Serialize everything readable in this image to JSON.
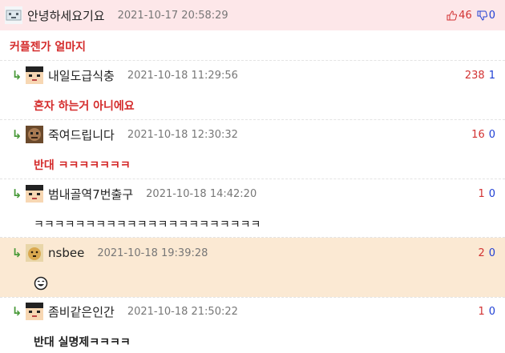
{
  "post": {
    "nick": "안녕하세요기요",
    "date": "2021-10-17 20:58:29",
    "up": "46",
    "down": "0",
    "text": "커플젠가 얼마지"
  },
  "replies": [
    {
      "nick": "내일도급식충",
      "date": "2021-10-18 11:29:56",
      "up": "238",
      "down": "1",
      "text": "혼자 하는거 아니에요"
    },
    {
      "nick": "죽여드립니다",
      "date": "2021-10-18 12:30:32",
      "up": "16",
      "down": "0",
      "text": "반대 ㅋㅋㅋㅋㅋㅋㅋ"
    },
    {
      "nick": "범내골역7번출구",
      "date": "2021-10-18 14:42:20",
      "up": "1",
      "down": "0",
      "text": "ㅋㅋㅋㅋㅋㅋㅋㅋㅋㅋㅋㅋㅋㅋㅋㅋㅋㅋㅋㅋㅋㅋ"
    },
    {
      "nick": "nsbee",
      "date": "2021-10-18 19:39:28",
      "up": "2",
      "down": "0",
      "text": ""
    },
    {
      "nick": "좀비같은인간",
      "date": "2021-10-18 21:50:22",
      "up": "1",
      "down": "0",
      "text": "반대 실명제ㅋㅋㅋㅋ"
    }
  ],
  "colors": {
    "highlight_pink": "#fde7e9",
    "highlight_beige": "#fbe9d3",
    "up": "#d23232",
    "down": "#1f3fd4",
    "reply_arrow": "#4a9a3a"
  },
  "icons": {
    "reply": "reply-arrow-icon",
    "up": "thumbs-up-icon",
    "down": "thumbs-down-icon",
    "emoji": "laughing-emoji-icon"
  }
}
